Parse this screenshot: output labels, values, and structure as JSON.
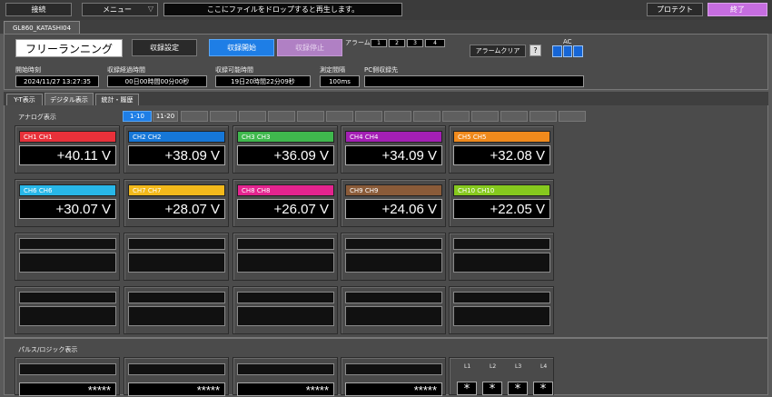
{
  "toolbar": {
    "connect_label": "接続",
    "menu_label": "メニュー",
    "drop_hint": "ここにファイルをドロップすると再生します。",
    "protect_label": "プロテクト",
    "exit_label": "終了"
  },
  "device_tab": "GL860_KATASHI04",
  "status": {
    "mode": "フリーランニング",
    "record_settings_label": "収録設定",
    "record_start_label": "収録開始",
    "record_stop_label": "収録停止",
    "alarm_label": "アラーム",
    "alarm_indicators": [
      "1",
      "2",
      "3",
      "4"
    ],
    "alarm_clear_label": "アラームクリア",
    "help_label": "?",
    "ac_label": "AC"
  },
  "info": {
    "start_time_label": "開始時刻",
    "start_time_value": "2024/11/27 13:27:35",
    "elapsed_label": "収録経過時間",
    "elapsed_value": "00日00時間00分00秒",
    "remaining_label": "収録可能時間",
    "remaining_value": "19日20時間22分09秒",
    "interval_label": "測定間隔",
    "interval_value": "100ms",
    "pc_dest_label": "PC側収録先",
    "pc_dest_value": ""
  },
  "view_tabs": [
    "Y-T表示",
    "デジタル表示",
    "統計・履歴"
  ],
  "analog": {
    "title": "アナログ表示",
    "pages": [
      "1-10",
      "11-20"
    ],
    "channels": [
      {
        "name": "CH1  CH1",
        "value": "+40.11  V",
        "color": "#e8313a"
      },
      {
        "name": "CH2  CH2",
        "value": "+38.09  V",
        "color": "#1677d8"
      },
      {
        "name": "CH3  CH3",
        "value": "+36.09  V",
        "color": "#3fb84d"
      },
      {
        "name": "CH4  CH4",
        "value": "+34.09  V",
        "color": "#a41fb5"
      },
      {
        "name": "CH5  CH5",
        "value": "+32.08  V",
        "color": "#f08a1c"
      },
      {
        "name": "CH6  CH6",
        "value": "+30.07  V",
        "color": "#28b7e8"
      },
      {
        "name": "CH7  CH7",
        "value": "+28.07  V",
        "color": "#f3b91b"
      },
      {
        "name": "CH8  CH8",
        "value": "+26.07  V",
        "color": "#e4248f"
      },
      {
        "name": "CH9  CH9",
        "value": "+24.06  V",
        "color": "#8a5b39"
      },
      {
        "name": "CH10  CH10",
        "value": "+22.05  V",
        "color": "#86c91e"
      }
    ]
  },
  "pulse": {
    "title": "パルス/ロジック表示",
    "values": [
      "*****",
      "*****",
      "*****",
      "*****"
    ],
    "logic_labels": [
      "L1",
      "L2",
      "L3",
      "L4"
    ],
    "logic_values": [
      "*",
      "*",
      "*",
      "*"
    ]
  }
}
